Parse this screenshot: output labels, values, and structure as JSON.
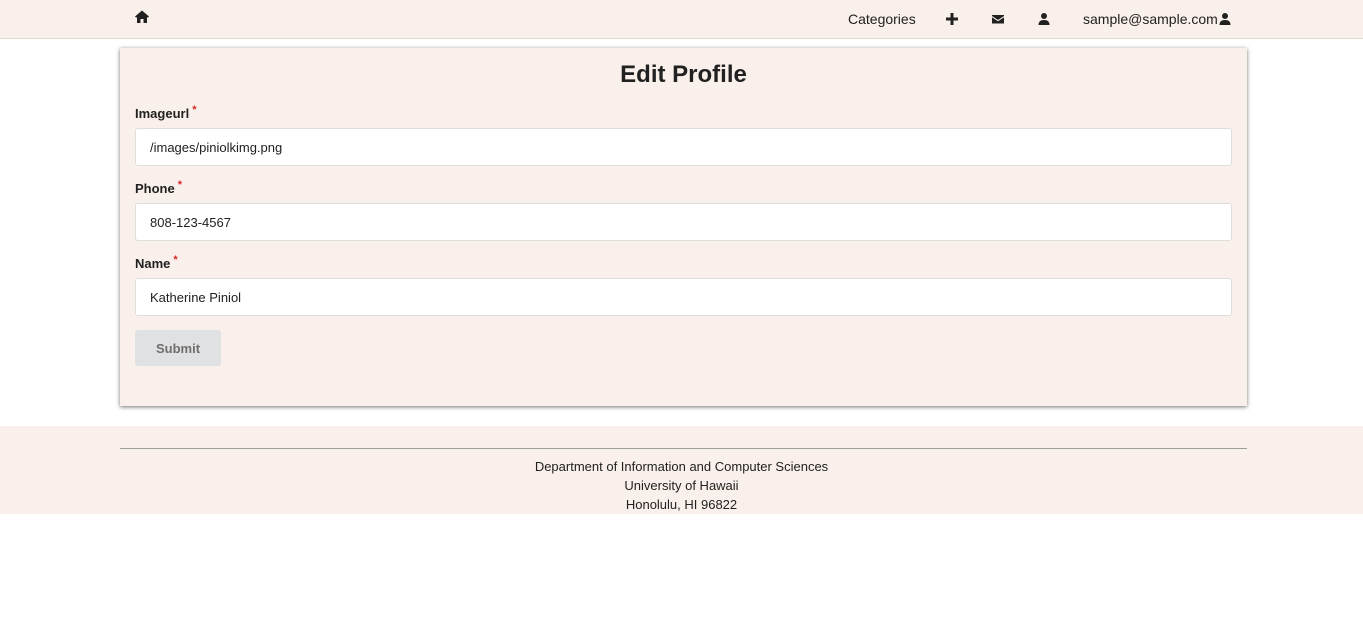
{
  "navbar": {
    "home_icon": "home-icon",
    "categories_label": "Categories",
    "add_icon": "plus-icon",
    "mail_icon": "envelope-icon",
    "profile_icon": "user-icon",
    "user_email": "sample@sample.com",
    "user_menu_icon": "user-icon"
  },
  "form": {
    "title": "Edit Profile",
    "required_mark": "*",
    "fields": [
      {
        "label": "Imageurl",
        "value": "/images/piniolkimg.png"
      },
      {
        "label": "Phone",
        "value": "808-123-4567"
      },
      {
        "label": "Name",
        "value": "Katherine Piniol"
      }
    ],
    "submit_label": "Submit"
  },
  "footer": {
    "line1": "Department of Information and Computer Sciences",
    "line2": "University of Hawaii",
    "line3": "Honolulu, HI 96822"
  },
  "colors": {
    "page_background": "#ffffff",
    "panel_background": "#faf0eb",
    "required_mark": "#db2828",
    "submit_button": "#e0e1e2"
  }
}
